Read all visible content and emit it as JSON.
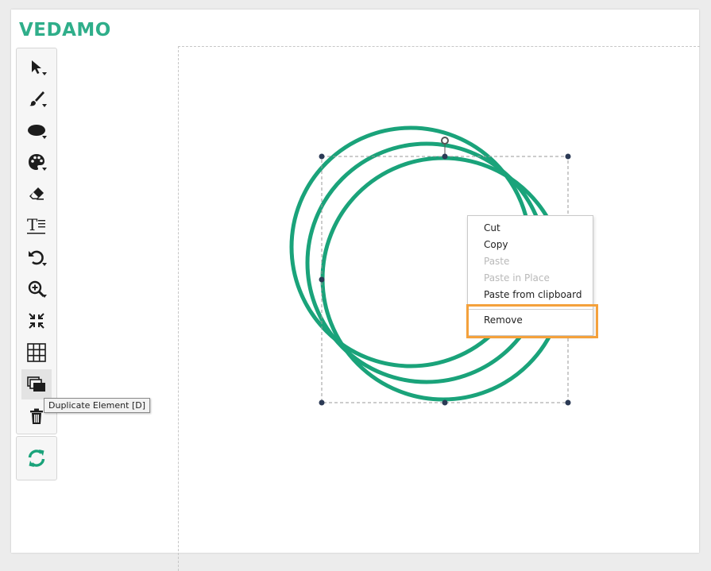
{
  "app": {
    "logo_text": "VEDAMO",
    "accent_color": "#1aa37a",
    "highlight_color": "#f4a13c"
  },
  "toolbar": {
    "tools": [
      {
        "name": "select-tool",
        "icon": "cursor-arrow-icon",
        "has_submenu": true
      },
      {
        "name": "brush-tool",
        "icon": "brush-icon",
        "has_submenu": true
      },
      {
        "name": "shape-tool",
        "icon": "ellipse-icon",
        "has_submenu": true
      },
      {
        "name": "color-tool",
        "icon": "palette-icon",
        "has_submenu": true
      },
      {
        "name": "eraser-tool",
        "icon": "eraser-icon",
        "has_submenu": false
      },
      {
        "name": "text-tool",
        "icon": "text-icon",
        "has_submenu": false
      },
      {
        "name": "undo-tool",
        "icon": "undo-icon",
        "has_submenu": true
      },
      {
        "name": "zoom-tool",
        "icon": "zoom-in-icon",
        "has_submenu": true
      },
      {
        "name": "fit-tool",
        "icon": "compress-icon",
        "has_submenu": false
      },
      {
        "name": "grid-tool",
        "icon": "grid-icon",
        "has_submenu": false
      },
      {
        "name": "duplicate-tool",
        "icon": "duplicate-icon",
        "has_submenu": false,
        "active": true
      },
      {
        "name": "delete-tool",
        "icon": "trash-icon",
        "has_submenu": false
      }
    ],
    "refresh_icon": "refresh-icon"
  },
  "tooltip": {
    "text": "Duplicate Element [D]"
  },
  "context_menu": {
    "items": [
      {
        "label": "Cut",
        "enabled": true
      },
      {
        "label": "Copy",
        "enabled": true
      },
      {
        "label": "Paste",
        "enabled": false
      },
      {
        "label": "Paste in Place",
        "enabled": false
      },
      {
        "label": "Paste from clipboard",
        "enabled": true
      },
      {
        "label": "Remove",
        "enabled": true,
        "highlighted": true
      }
    ]
  },
  "canvas": {
    "shapes": [
      {
        "type": "circle",
        "stroke": "#1aa37a"
      },
      {
        "type": "circle",
        "stroke": "#1aa37a"
      },
      {
        "type": "circle",
        "stroke": "#1aa37a"
      }
    ],
    "selection_handle_color": "#2b3a55"
  }
}
